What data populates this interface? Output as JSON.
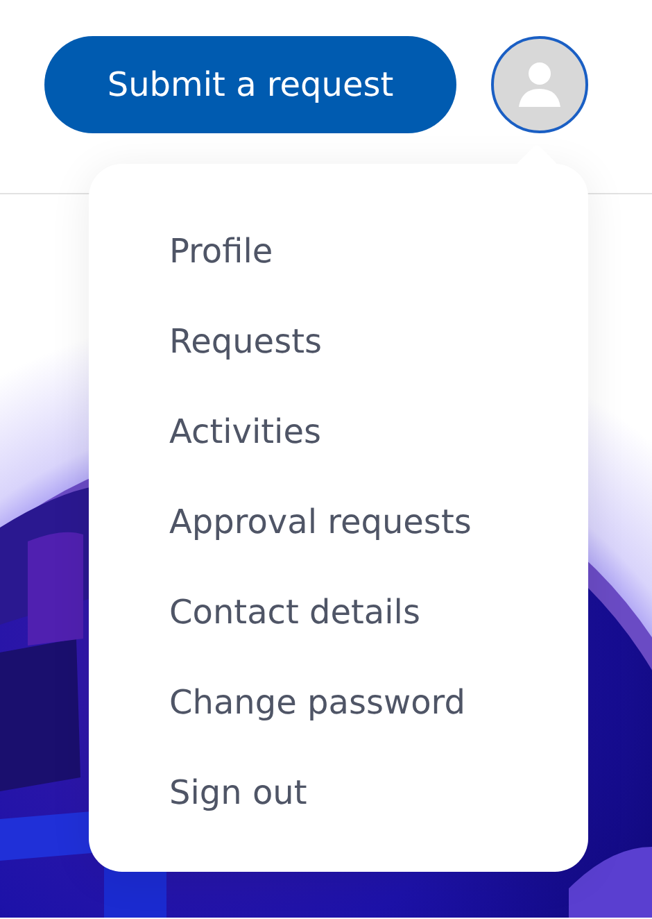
{
  "header": {
    "submit_button": "Submit a request",
    "avatar": {
      "kind": "placeholder",
      "expanded": true
    }
  },
  "user_menu": {
    "items": [
      {
        "label": "Profile"
      },
      {
        "label": "Requests"
      },
      {
        "label": "Activities"
      },
      {
        "label": "Approval requests"
      },
      {
        "label": "Contact details"
      },
      {
        "label": "Change password"
      },
      {
        "label": "Sign out"
      }
    ]
  }
}
